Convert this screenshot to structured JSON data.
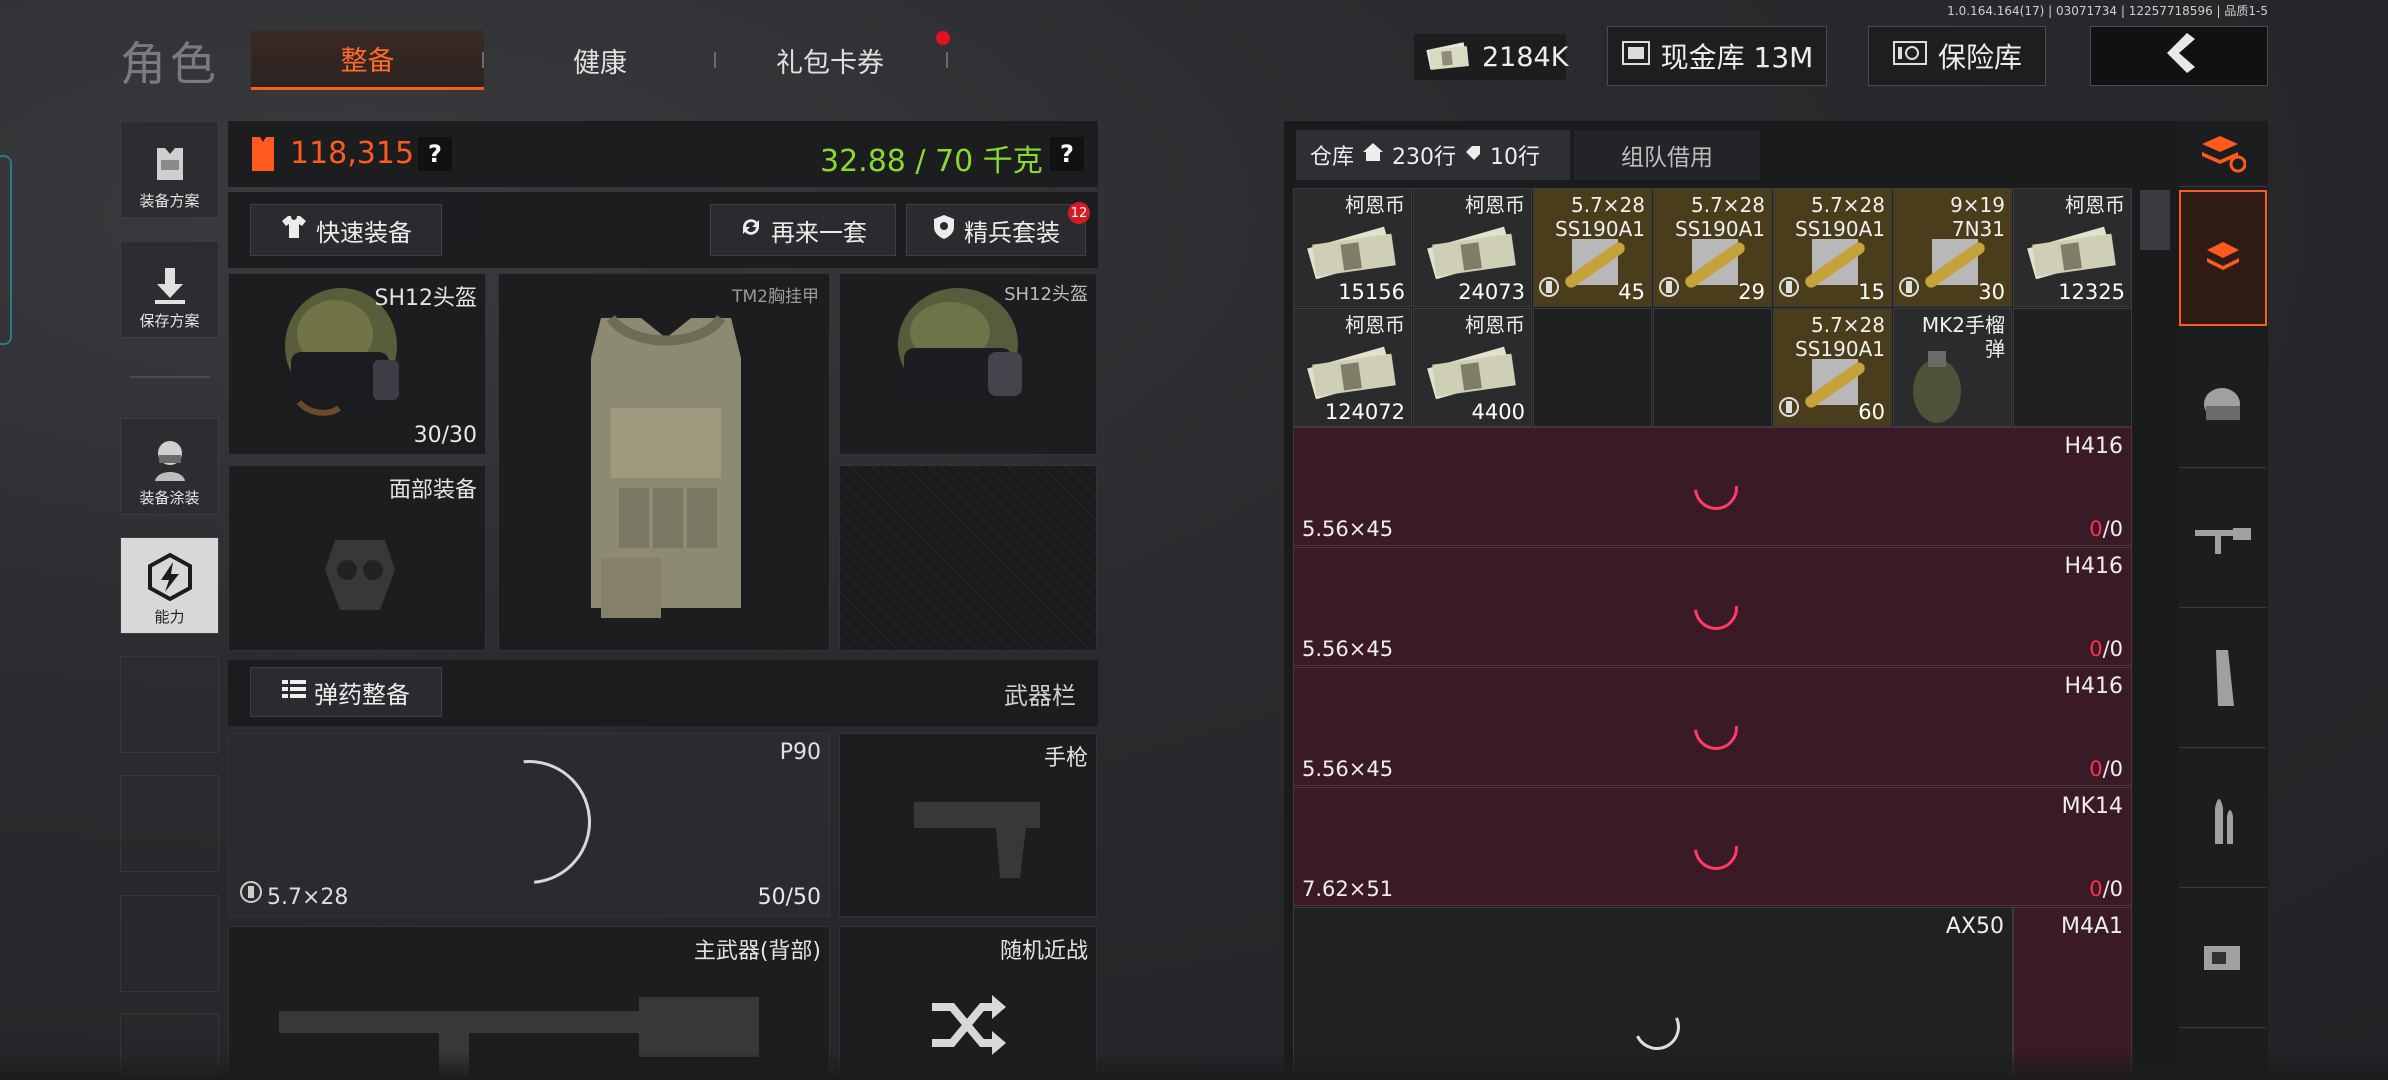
{
  "build_info": "1.0.164.164(17) | 03071734 | 12257718596 | 品质1-5",
  "title": "角色",
  "tabs": [
    "整备",
    "健康",
    "礼包卡券"
  ],
  "currency": {
    "cash": "2184K",
    "cash_vault_label": "现金库 13M",
    "insurance_label": "保险库"
  },
  "icons": {
    "back": "back-arrow-icon",
    "cash": "banknote-icon",
    "vault": "cash-vault-icon",
    "safe": "safe-icon"
  },
  "sidebar": [
    {
      "label": "装备方案",
      "icon": "vest-icon"
    },
    {
      "label": "保存方案",
      "icon": "download-icon"
    },
    {
      "label": "装备涂装",
      "icon": "soldier-icon"
    },
    {
      "label": "能力",
      "icon": "lightning-hex-icon"
    }
  ],
  "loadout": {
    "value": "118,315",
    "weight": "32.88 / 70 千克",
    "help": "?",
    "quick_equip": "快速装备",
    "again": "再来一套",
    "elite": "精兵套装",
    "elite_badge": "12"
  },
  "slots": {
    "helmet": "SH12头盔",
    "helmet_dur": "30/30",
    "armor": "TM2胸挂甲",
    "helmet2": "SH12头盔",
    "face": "面部装备"
  },
  "ammo_btn": "弹药整备",
  "weapon_bar": "武器栏",
  "weapons": {
    "primary": "P90",
    "primary_cal": "5.7×28",
    "primary_ammo": "50/50",
    "pistol": "手枪",
    "back": "主武器(背部)",
    "melee": "随机近战"
  },
  "colors": {
    "accent": "#ff5a1e",
    "weight": "#8cd832",
    "red": "#ff3050"
  },
  "warehouse": {
    "label": "仓库",
    "rows1": "230行",
    "rows2": "10行",
    "team": "组队借用"
  },
  "grid_row1": [
    {
      "name": "柯恩币",
      "qty": "15156",
      "type": "money"
    },
    {
      "name": "柯恩币",
      "qty": "24073",
      "type": "money"
    },
    {
      "name": "5.7×28\nSS190A1",
      "qty": "45",
      "type": "ammo"
    },
    {
      "name": "5.7×28\nSS190A1",
      "qty": "29",
      "type": "ammo"
    },
    {
      "name": "5.7×28\nSS190A1",
      "qty": "15",
      "type": "ammo"
    },
    {
      "name": "9×19\n7N31",
      "qty": "30",
      "type": "ammo"
    },
    {
      "name": "柯恩币",
      "qty": "12325",
      "type": "money"
    }
  ],
  "grid_row2": [
    {
      "name": "柯恩币",
      "qty": "124072",
      "type": "money"
    },
    {
      "name": "柯恩币",
      "qty": "4400",
      "type": "money"
    },
    {
      "name": "",
      "qty": "",
      "type": "empty"
    },
    {
      "name": "",
      "qty": "",
      "type": "empty"
    },
    {
      "name": "5.7×28\nSS190A1",
      "qty": "60",
      "type": "ammo"
    },
    {
      "name": "MK2手榴\n弹",
      "qty": "",
      "type": "grenade"
    },
    {
      "name": "",
      "qty": "",
      "type": "empty"
    }
  ],
  "guns": [
    {
      "name": "H416",
      "cal": "5.56×45",
      "cnt_a": "0",
      "cnt_b": "/0"
    },
    {
      "name": "H416",
      "cal": "5.56×45",
      "cnt_a": "0",
      "cnt_b": "/0"
    },
    {
      "name": "H416",
      "cal": "5.56×45",
      "cnt_a": "0",
      "cnt_b": "/0"
    },
    {
      "name": "MK14",
      "cal": "7.62×51",
      "cnt_a": "0",
      "cnt_b": "/0"
    }
  ],
  "last_row": {
    "a": "AX50",
    "b": "M4A1"
  },
  "right_tabs": [
    "sort-stack-icon",
    "stack-icon",
    "helmet-icon",
    "rifle-icon",
    "magazine-icon",
    "bullet-icon",
    "scope-icon"
  ]
}
